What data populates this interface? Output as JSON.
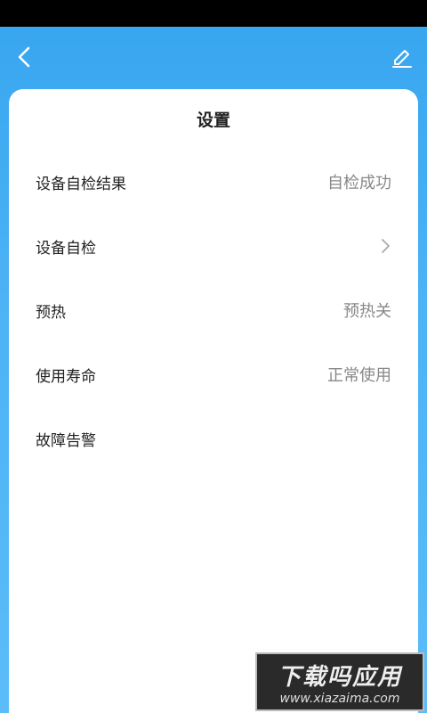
{
  "header": {
    "back_icon": "chevron-left-icon",
    "edit_icon": "pencil-icon"
  },
  "card": {
    "title": "设置",
    "rows": [
      {
        "label": "设备自检结果",
        "value": "自检成功"
      },
      {
        "label": "设备自检",
        "value": "",
        "icon": "chevron-right-icon"
      },
      {
        "label": "预热",
        "value": "预热关"
      },
      {
        "label": "使用寿命",
        "value": "正常使用"
      },
      {
        "label": "故障告警",
        "value": ""
      }
    ]
  },
  "watermark": {
    "title": "下载吗应用",
    "url": "www.xiazaima.com"
  },
  "colors": {
    "background_top": "#38a6f0",
    "background_bottom": "#5bbcf8",
    "card": "#ffffff",
    "label_text": "#222222",
    "value_text": "#888888"
  }
}
